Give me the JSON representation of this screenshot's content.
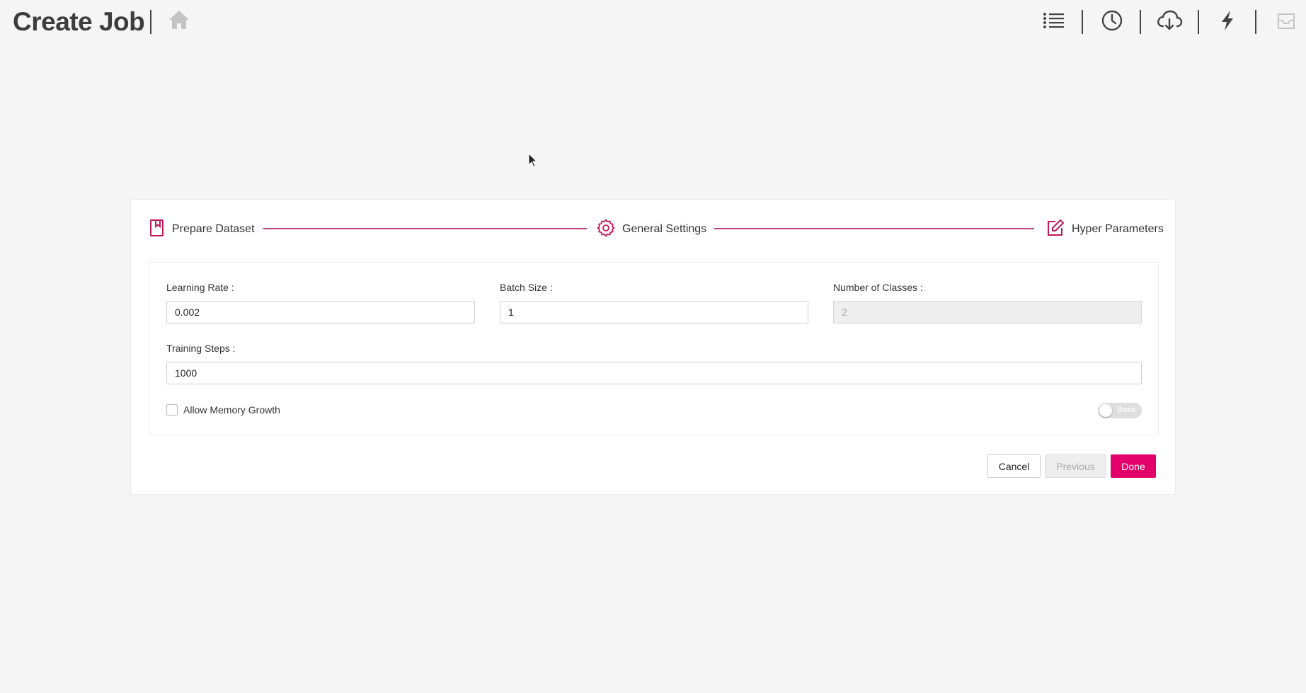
{
  "header": {
    "title": "Create Job"
  },
  "toolbar": {
    "icons": [
      "list-icon",
      "clock-icon",
      "cloud-download-icon",
      "lightning-icon",
      "inbox-icon"
    ]
  },
  "stepper": {
    "steps": [
      {
        "label": "Prepare Dataset",
        "icon": "book-icon"
      },
      {
        "label": "General Settings",
        "icon": "gear-icon"
      },
      {
        "label": "Hyper Parameters",
        "icon": "edit-icon"
      }
    ]
  },
  "form": {
    "learning_rate": {
      "label": "Learning Rate :",
      "value": "0.002"
    },
    "batch_size": {
      "label": "Batch Size :",
      "value": "1"
    },
    "num_classes": {
      "label": "Number of Classes :",
      "value": "2"
    },
    "training_steps": {
      "label": "Training Steps :",
      "value": "1000"
    },
    "allow_memory_growth": {
      "label": "Allow Memory Growth",
      "checked": false
    },
    "mode_toggle": {
      "label": "Basic"
    }
  },
  "actions": {
    "cancel": "Cancel",
    "previous": "Previous",
    "done": "Done"
  },
  "colors": {
    "accent": "#e4006b",
    "step_accent": "#b8457f",
    "background": "#f4f5f4"
  }
}
